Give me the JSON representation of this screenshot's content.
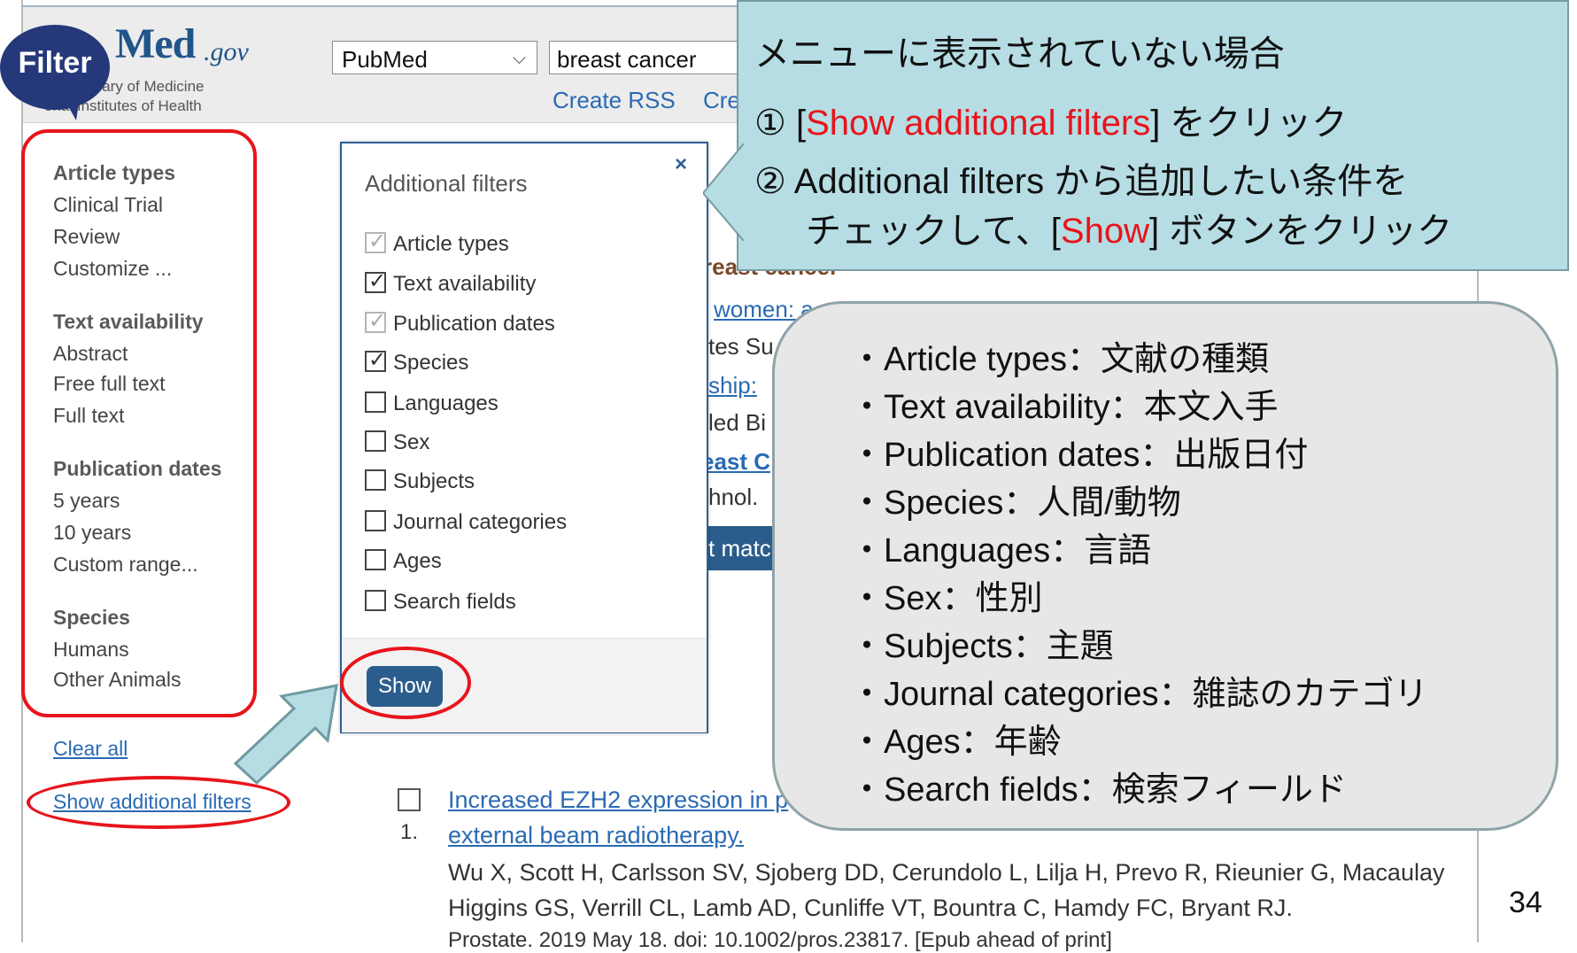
{
  "header": {
    "logo_mark": "Med",
    "logo_gov": ".gov",
    "logo_line1": "onal Library of Medicine",
    "logo_line2": "onal Institutes of Health",
    "db_select": "PubMed",
    "query": "breast cancer",
    "create_rss": "Create RSS",
    "create_alert_partial": "Cre"
  },
  "filter_bubble": "Filter",
  "sidebar": {
    "article_types": {
      "heading": "Article types",
      "items": [
        "Clinical Trial",
        "Review",
        "Customize ..."
      ]
    },
    "text_availability": {
      "heading": "Text availability",
      "items": [
        "Abstract",
        "Free full text",
        "Full text"
      ]
    },
    "publication_dates": {
      "heading": "Publication dates",
      "items": [
        "5 years",
        "10 years",
        "Custom range..."
      ]
    },
    "species": {
      "heading": "Species",
      "items": [
        "Humans",
        "Other Animals"
      ]
    },
    "clear_all": "Clear all",
    "show_additional": "Show additional filters"
  },
  "panel": {
    "title": "Additional filters",
    "close": "×",
    "options": [
      {
        "label": "Article types",
        "checked": true,
        "disabled": true
      },
      {
        "label": "Text availability",
        "checked": true,
        "disabled": false
      },
      {
        "label": "Publication dates",
        "checked": true,
        "disabled": true
      },
      {
        "label": "Species",
        "checked": true,
        "disabled": false
      },
      {
        "label": "Languages",
        "checked": false,
        "disabled": false
      },
      {
        "label": "Sex",
        "checked": false,
        "disabled": false
      },
      {
        "label": "Subjects",
        "checked": false,
        "disabled": false
      },
      {
        "label": "Journal categories",
        "checked": false,
        "disabled": false
      },
      {
        "label": "Ages",
        "checked": false,
        "disabled": false
      },
      {
        "label": "Search fields",
        "checked": false,
        "disabled": false
      }
    ],
    "show_button": "Show"
  },
  "background_snippets": {
    "s1": "reast cancer",
    "s2": "women: a",
    "s3": "tes Su",
    "s4": "ship: ",
    "s5": "led Bi",
    "s6": "east C",
    "s7": "hnol.",
    "s8": "t matc"
  },
  "callout": {
    "line1": "メニューに表示されていない場合",
    "line2_prefix": "① [",
    "line2_red": "Show additional filters",
    "line2_suffix": "] をクリック",
    "line3": "② Additional filters から追加したい条件を",
    "line4_prefix": "チェックして、[",
    "line4_red": "Show",
    "line4_suffix": "] ボタンをクリック"
  },
  "definitions": [
    "・Article types：文献の種類",
    "・Text availability：本文入手",
    "・Publication dates：出版日付",
    "・Species：人間/動物",
    "・Languages：言語",
    "・Sex：性別",
    "・Subjects：主題",
    "・Journal categories：雑誌のカテゴリ",
    "・Ages：年齢",
    "・Search fields：検索フィールド"
  ],
  "result": {
    "number": "1.",
    "title_line1": "Increased EZH2 expression in p",
    "title_line2": "external beam radiotherapy.",
    "authors_line1": "Wu X, Scott H, Carlsson SV, Sjoberg DD, Cerundolo L, Lilja H, Prevo R, Rieunier G, Macaulay",
    "authors_line2": "Higgins GS, Verrill CL, Lamb AD, Cunliffe VT, Bountra C, Hamdy FC, Bryant RJ.",
    "citation": "Prostate. 2019 May 18. doi: 10.1002/pros.23817. [Epub ahead of print]"
  },
  "page_number": "34",
  "colors": {
    "highlight_red": "#e8141b",
    "callout_bg": "#b6dde4",
    "link_blue": "#2a6ab3",
    "button_blue": "#2b5d8c"
  }
}
